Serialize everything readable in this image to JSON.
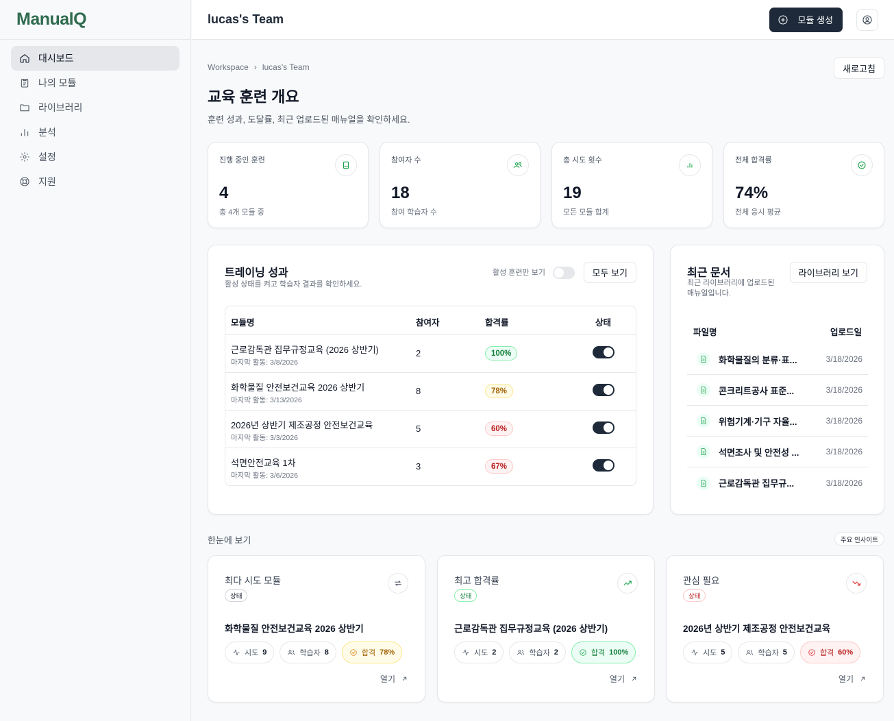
{
  "app": {
    "logo": "ManualQ",
    "team": "lucas's Team",
    "create_button": "모듈 생성"
  },
  "sidebar": {
    "items": [
      {
        "label": "대시보드",
        "icon": "home-icon",
        "active": true
      },
      {
        "label": "나의 모듈",
        "icon": "clipboard-icon"
      },
      {
        "label": "라이브러리",
        "icon": "folder-icon"
      },
      {
        "label": "분석",
        "icon": "bar-chart-icon"
      },
      {
        "label": "설정",
        "icon": "gear-icon"
      },
      {
        "label": "지원",
        "icon": "lifebuoy-icon"
      }
    ]
  },
  "breadcrumb": {
    "root": "Workspace",
    "current": "lucas's Team"
  },
  "page": {
    "refresh": "새로고침",
    "title": "교육 훈련 개요",
    "subtitle": "훈련 성과, 도달률, 최근 업로드된 매뉴얼을 확인하세요."
  },
  "stats": [
    {
      "label": "진행 중인 훈련",
      "value": "4",
      "sub": "총 4개 모듈 중",
      "icon": "book-icon"
    },
    {
      "label": "참여자 수",
      "value": "18",
      "sub": "참여 학습자 수",
      "icon": "users-icon"
    },
    {
      "label": "총 시도 횟수",
      "value": "19",
      "sub": "모든 모듈 합계",
      "icon": "bar-chart-icon"
    },
    {
      "label": "전체 합격률",
      "value": "74%",
      "sub": "전체 응시 평균",
      "icon": "check-circle-icon"
    }
  ],
  "training": {
    "title": "트레이닝 성과",
    "subtitle": "활성 상태를 켜고 학습자 결과를 확인하세요.",
    "active_only_label": "활성 훈련만 보기",
    "view_all": "모두 보기",
    "headers": {
      "name": "모듈명",
      "participants": "참여자",
      "pass_rate": "합격률",
      "status": "상태"
    },
    "rows": [
      {
        "name": "근로감독관 집무규정교육 (2026 상반기)",
        "last": "마지막 활동: 3/8/2026",
        "participants": "2",
        "rate": "100%",
        "tone": "green"
      },
      {
        "name": "화학물질 안전보건교육 2026 상반기",
        "last": "마지막 활동: 3/13/2026",
        "participants": "8",
        "rate": "78%",
        "tone": "yellow"
      },
      {
        "name": "2026년 상반기 제조공정 안전보건교육",
        "last": "마지막 활동: 3/3/2026",
        "participants": "5",
        "rate": "60%",
        "tone": "red"
      },
      {
        "name": "석면안전교육 1차",
        "last": "마지막 활동: 3/6/2026",
        "participants": "3",
        "rate": "67%",
        "tone": "red"
      }
    ]
  },
  "documents": {
    "title": "최근 문서",
    "subtitle": "최근 라이브러리에 업로드된 매뉴얼입니다.",
    "library_button": "라이브러리 보기",
    "headers": {
      "file": "파일명",
      "uploaded": "업로드일"
    },
    "rows": [
      {
        "name": "화학물질의 분류·표...",
        "date": "3/18/2026"
      },
      {
        "name": "콘크리트공사 표준...",
        "date": "3/18/2026"
      },
      {
        "name": "위험기계·기구 자율...",
        "date": "3/18/2026"
      },
      {
        "name": "석면조사 및 안전성 ...",
        "date": "3/18/2026"
      },
      {
        "name": "근로감독관 집무규...",
        "date": "3/18/2026"
      }
    ]
  },
  "glance": {
    "title": "한눈에 보기",
    "insight": "주요 인사이트",
    "cards": [
      {
        "title": "최다 시도 모듈",
        "pill": "상태",
        "module": "화학물질 안전보건교육 2026 상반기",
        "attempt_label": "시도",
        "attempts": "9",
        "learner_label": "학습자",
        "learners": "8",
        "pass_label": "합격",
        "pass": "78%",
        "open": "열기",
        "tone": "yellow",
        "icon": "repeat-icon"
      },
      {
        "title": "최고 합격률",
        "pill": "상태",
        "module": "근로감독관 집무규정교육 (2026 상반기)",
        "attempt_label": "시도",
        "attempts": "2",
        "learner_label": "학습자",
        "learners": "2",
        "pass_label": "합격",
        "pass": "100%",
        "open": "열기",
        "tone": "green",
        "icon": "trending-up-icon"
      },
      {
        "title": "관심 필요",
        "pill": "상태",
        "module": "2026년 상반기 제조공정 안전보건교육",
        "attempt_label": "시도",
        "attempts": "5",
        "learner_label": "학습자",
        "learners": "5",
        "pass_label": "합격",
        "pass": "60%",
        "open": "열기",
        "tone": "red",
        "icon": "trending-down-icon"
      }
    ]
  },
  "colors": {
    "brand": "#2f6b4f",
    "dark": "#1e2a3a",
    "green": "#16a34a",
    "red": "#dc2626",
    "yellow": "#d97706"
  }
}
